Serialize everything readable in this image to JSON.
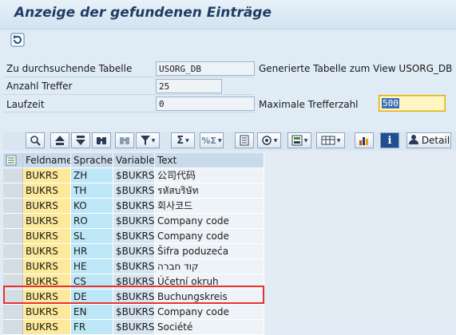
{
  "window": {
    "title": "Anzeige der gefundenen Einträge"
  },
  "appbar": {
    "refresh_icon": "refresh-icon"
  },
  "form": {
    "table_label": "Zu durchsuchende Tabelle",
    "table_value": "USORG_DB",
    "table_desc": "Generierte Tabelle zum View USORG_DB",
    "hits_label": "Anzahl Treffer",
    "hits_value": "25",
    "runtime_label": "Laufzeit",
    "runtime_value": "0",
    "maxhits_label": "Maximale Trefferzahl",
    "maxhits_value": "500"
  },
  "toolbar": {
    "icons": [
      "details-icon",
      "sort-ascending-icon",
      "sort-descending-icon",
      "find-icon",
      "find-next-icon",
      "filter-icon",
      "sum-icon",
      "subtotal-icon",
      "print-preview-icon",
      "export-icon",
      "layout-icon",
      "columns-icon",
      "graphic-icon",
      "info-icon",
      "detail-icon"
    ],
    "detail_label": "Detail"
  },
  "table": {
    "columns": [
      "Feldname",
      "Sprache",
      "Variable",
      "Text"
    ],
    "rows": [
      [
        "BUKRS",
        "ZH",
        "$BUKRS",
        "公司代码"
      ],
      [
        "BUKRS",
        "TH",
        "$BUKRS",
        "รหัสบริษัท"
      ],
      [
        "BUKRS",
        "KO",
        "$BUKRS",
        "회사코드"
      ],
      [
        "BUKRS",
        "RO",
        "$BUKRS",
        "Company code"
      ],
      [
        "BUKRS",
        "SL",
        "$BUKRS",
        "Company code"
      ],
      [
        "BUKRS",
        "HR",
        "$BUKRS",
        "Šifra poduzeća"
      ],
      [
        "BUKRS",
        "HE",
        "$BUKRS",
        "קוד חברה"
      ],
      [
        "BUKRS",
        "CS",
        "$BUKRS",
        "Účetní okruh"
      ],
      [
        "BUKRS",
        "DE",
        "$BUKRS",
        "Buchungskreis"
      ],
      [
        "BUKRS",
        "EN",
        "$BUKRS",
        "Company code"
      ],
      [
        "BUKRS",
        "FR",
        "$BUKRS",
        "Société"
      ]
    ],
    "highlighted_row": 8
  },
  "colors": {
    "background": "#dfebf5",
    "key_column": "#fde99a",
    "lang_column": "#bde7f7",
    "highlight_border": "#e8322f",
    "maxhits_field": "#fff6c4"
  }
}
